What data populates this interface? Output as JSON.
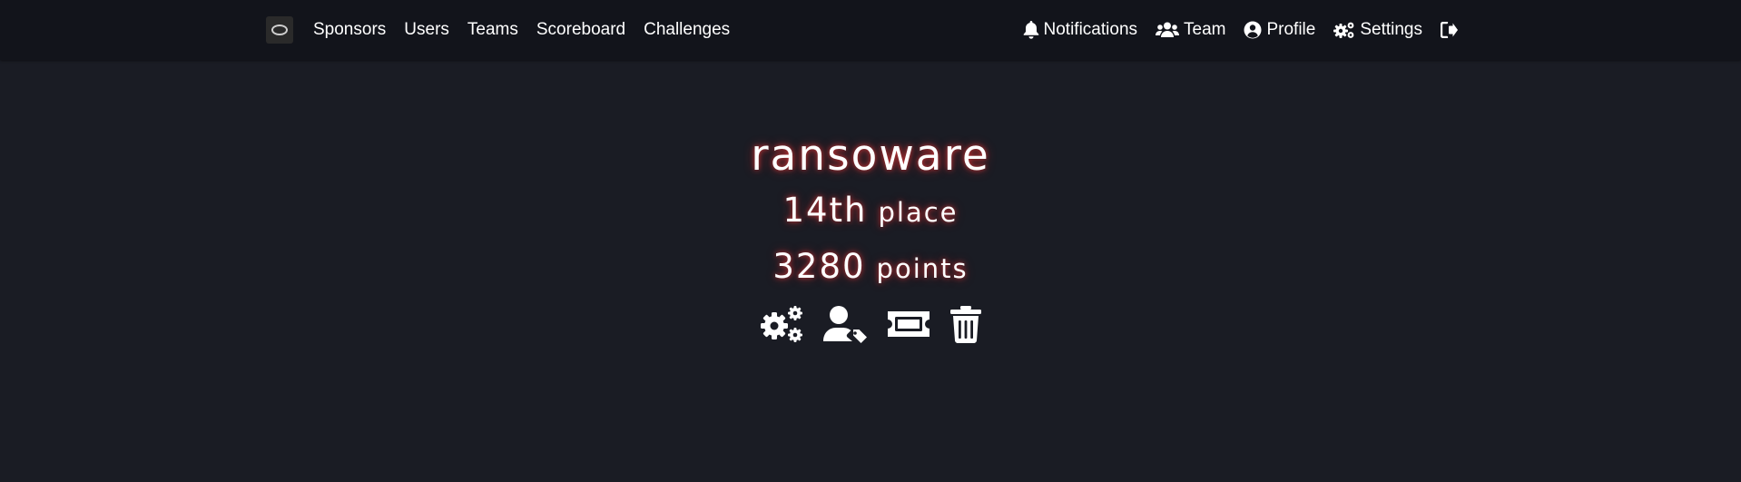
{
  "nav": {
    "left": [
      {
        "label": "Sponsors"
      },
      {
        "label": "Users"
      },
      {
        "label": "Teams"
      },
      {
        "label": "Scoreboard"
      },
      {
        "label": "Challenges"
      }
    ],
    "right": [
      {
        "label": "Notifications",
        "icon": "bell-icon"
      },
      {
        "label": "Team",
        "icon": "users-icon"
      },
      {
        "label": "Profile",
        "icon": "user-circle-icon"
      },
      {
        "label": "Settings",
        "icon": "cogs-icon"
      },
      {
        "label": "",
        "icon": "logout-icon"
      }
    ]
  },
  "team": {
    "name": "ransoware",
    "place": "14th",
    "place_unit": "place",
    "points": "3280",
    "points_unit": "points"
  },
  "actions": [
    {
      "icon": "settings-cogs-icon"
    },
    {
      "icon": "user-tag-icon"
    },
    {
      "icon": "ticket-icon"
    },
    {
      "icon": "trash-icon"
    }
  ],
  "colors": {
    "background": "#1a1c24",
    "navbar": "#12141b",
    "glow": "#ff3c3c"
  }
}
